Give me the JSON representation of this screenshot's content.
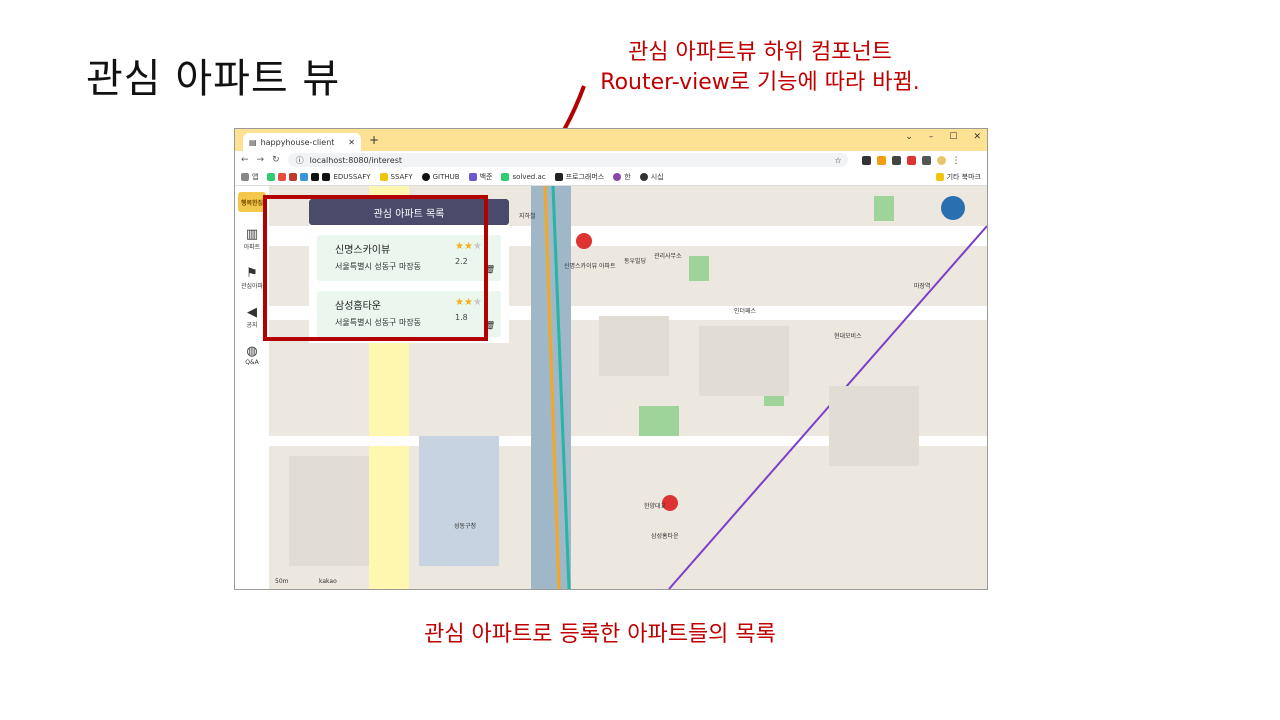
{
  "slide": {
    "title": "관심 아파트 뷰",
    "annotation_top_line1": "관심 아파트뷰 하위 컴포넌트",
    "annotation_top_line2": "Router-view로 기능에 따라 바뀜.",
    "annotation_bottom": "관심 아파트로 등록한 아파트들의 목록",
    "accent_color": "#c00000"
  },
  "browser": {
    "tab_title": "happyhouse-client",
    "url": "localhost:8080/interest",
    "bookmarks": [
      "앱",
      "EDUSSAFY",
      "SSAFY",
      "GITHUB",
      "백준",
      "solved.ac",
      "프로그래머스",
      "한",
      "시십"
    ],
    "bookmarks_right": "기타 북마크"
  },
  "sidenav": {
    "logo": "행복한집",
    "items": [
      {
        "label": "아파트",
        "icon": "building-icon"
      },
      {
        "label": "관심아파",
        "icon": "flag-icon"
      },
      {
        "label": "공지",
        "icon": "megaphone-icon"
      },
      {
        "label": "Q&A",
        "icon": "qa-icon"
      }
    ]
  },
  "panel": {
    "header": "관심 아파트 목록",
    "items": [
      {
        "name": "신명스카이뷰",
        "address": "서울특별시 성동구 마장동",
        "rating": "2.2",
        "stars": 2
      },
      {
        "name": "삼성홈타운",
        "address": "서울특별시 성동구 마장동",
        "rating": "1.8",
        "stars": 2
      }
    ]
  },
  "map": {
    "labels": [
      "신명스카이뷰 아파트",
      "동우빌딩",
      "관리사무소",
      "인더패스",
      "현대모비스",
      "성동구청",
      "삼성홈타운",
      "한양대교",
      "마장역",
      "지하철"
    ],
    "scale": "50m",
    "provider": "kakao"
  }
}
